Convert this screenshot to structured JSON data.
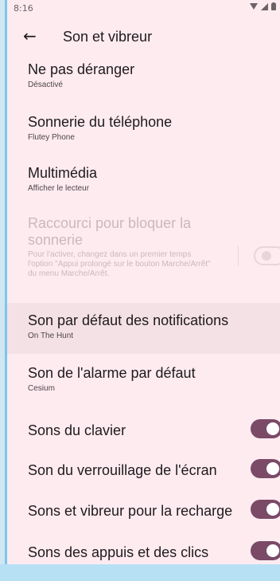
{
  "status": {
    "time": "8:16",
    "icons": [
      "wifi-icon",
      "signal-icon",
      "battery-icon"
    ]
  },
  "toolbar": {
    "title": "Son et vibreur"
  },
  "items": [
    {
      "title": "Ne pas déranger",
      "subtitle": "Désactivé"
    },
    {
      "title": "Sonnerie du téléphone",
      "subtitle": "Flutey Phone"
    },
    {
      "title": "Multimédia",
      "subtitle": "Afficher le lecteur"
    },
    {
      "title": "Raccourci pour bloquer la sonnerie",
      "subtitle": "Pour l'activer, changez dans un premier temps l'option \"Appui prolongé sur le bouton Marche/Arrêt\" du menu Marche/Arrêt.",
      "toggle": "off"
    },
    {
      "title": "Son par défaut des notifications",
      "subtitle": "On The Hunt"
    },
    {
      "title": "Son de l'alarme par défaut",
      "subtitle": "Cesium"
    },
    {
      "title": "Sons du clavier",
      "toggle": "on"
    },
    {
      "title": "Son du verrouillage de l'écran",
      "toggle": "on"
    },
    {
      "title": "Sons et vibreur pour la recharge",
      "toggle": "on"
    },
    {
      "title": "Sons des appuis et des clics",
      "toggle": "on"
    }
  ]
}
